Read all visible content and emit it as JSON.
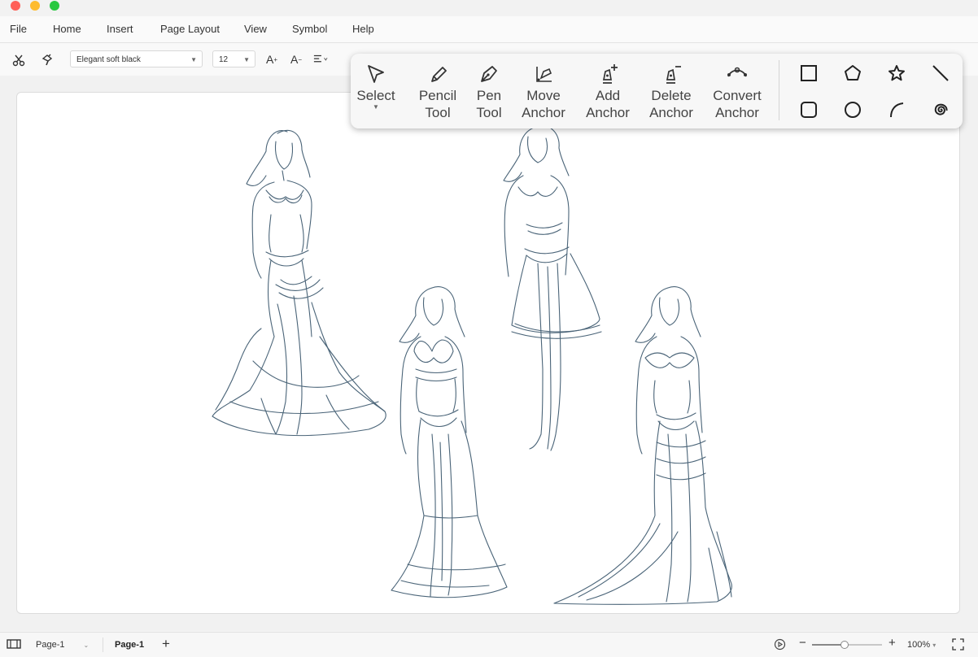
{
  "window": {
    "controls": [
      "close",
      "minimize",
      "maximize"
    ]
  },
  "menu": [
    "File",
    "Home",
    "Insert",
    "Page Layout",
    "View",
    "Symbol",
    "Help"
  ],
  "toolbar": {
    "font_name": "Elegant soft black",
    "font_size": "12"
  },
  "drawing_tools": [
    {
      "label": "Select",
      "icon": "select-arrow-icon"
    },
    {
      "label": "Pencil\nTool",
      "icon": "pencil-icon"
    },
    {
      "label": "Pen\nTool",
      "icon": "pen-icon"
    },
    {
      "label": "Move\nAnchor",
      "icon": "move-anchor-icon"
    },
    {
      "label": "Add\nAnchor",
      "icon": "add-anchor-icon"
    },
    {
      "label": "Delete\nAnchor",
      "icon": "delete-anchor-icon"
    },
    {
      "label": "Convert\nAnchor",
      "icon": "convert-anchor-icon"
    }
  ],
  "shapes": [
    "rectangle",
    "pentagon",
    "star",
    "line",
    "rounded-rectangle",
    "circle",
    "arc",
    "spiral"
  ],
  "status": {
    "page_selector": "Page-1",
    "page_tab": "Page-1",
    "zoom": "100%",
    "zoom_level": 0.45
  },
  "colors": {
    "sketch_stroke": "#4a6478",
    "close": "#ff5f57",
    "minimize": "#febc2e",
    "maximize": "#28c840"
  }
}
